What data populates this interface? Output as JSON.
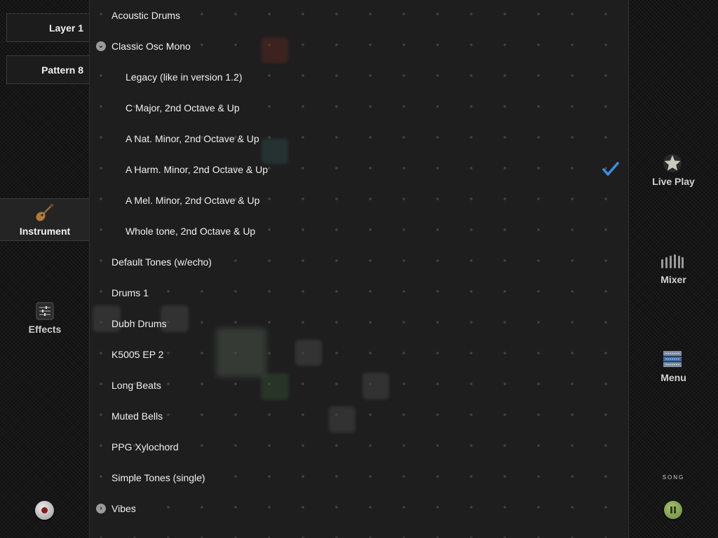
{
  "left_sidebar": {
    "layer_label": "Layer 1",
    "pattern_label": "Pattern 8",
    "instrument_label": "Instrument",
    "effects_label": "Effects"
  },
  "instrument_list": {
    "items": [
      {
        "label": "Acoustic Drums"
      },
      {
        "label": "Classic Osc Mono"
      },
      {
        "label": "Legacy (like in version 1.2)"
      },
      {
        "label": "C Major, 2nd Octave & Up"
      },
      {
        "label": "A Nat. Minor, 2nd Octave & Up"
      },
      {
        "label": "A Harm. Minor, 2nd Octave & Up"
      },
      {
        "label": "A Mel. Minor, 2nd Octave & Up"
      },
      {
        "label": "Whole tone, 2nd Octave & Up"
      },
      {
        "label": "Default Tones (w/echo)"
      },
      {
        "label": "Drums 1"
      },
      {
        "label": "Dubh Drums"
      },
      {
        "label": "K5005 EP 2"
      },
      {
        "label": "Long Beats"
      },
      {
        "label": "Muted Bells"
      },
      {
        "label": "PPG Xylochord"
      },
      {
        "label": "Simple Tones (single)"
      },
      {
        "label": "Vibes"
      }
    ]
  },
  "right_sidebar": {
    "live_play_label": "Live Play",
    "mixer_label": "Mixer",
    "menu_label": "Menu",
    "song_label": "SONG"
  },
  "icons": {
    "instrument": "guitar-icon",
    "effects": "sliders-icon",
    "record": "record-icon",
    "expanded": "chevron-down-icon",
    "collapsed": "chevron-right-icon",
    "selected": "checkmark-icon",
    "live_play": "star-icon",
    "mixer": "mixer-bars-icon",
    "menu": "menu-stack-icon",
    "pause": "pause-icon"
  },
  "colors": {
    "selection_check": "#3a8ee6",
    "pause_button": "#7a9a4a",
    "record_dot": "#8b1a1a"
  }
}
